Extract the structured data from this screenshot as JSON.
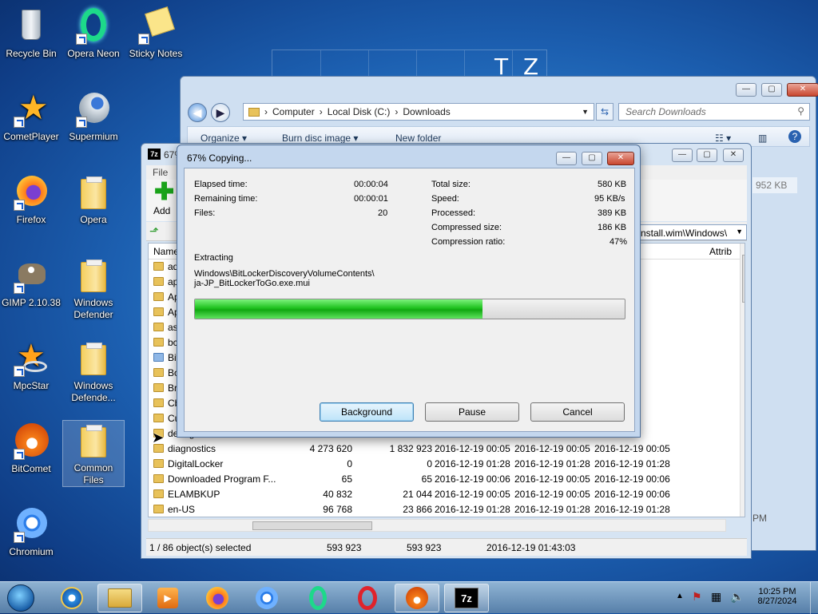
{
  "desktop": {
    "icons": [
      {
        "label": "Recycle Bin",
        "icon": "recycle-bin-icon"
      },
      {
        "label": "Opera Neon",
        "icon": "opera-neon-icon"
      },
      {
        "label": "Sticky Notes",
        "icon": "sticky-notes-icon"
      },
      {
        "label": "CometPlayer",
        "icon": "cometplayer-icon"
      },
      {
        "label": "Supermium",
        "icon": "supermium-icon"
      },
      {
        "label": "Firefox",
        "icon": "firefox-icon"
      },
      {
        "label": "Opera",
        "icon": "folder-icon"
      },
      {
        "label": "GIMP 2.10.38",
        "icon": "gimp-icon"
      },
      {
        "label": "Windows Defender",
        "icon": "folder-icon"
      },
      {
        "label": "MpcStar",
        "icon": "mpcstar-icon"
      },
      {
        "label": "Windows Defende...",
        "icon": "folder-icon"
      },
      {
        "label": "BitComet",
        "icon": "bitcomet-icon"
      },
      {
        "label": "Common Files",
        "icon": "folder-icon"
      },
      {
        "label": "Chromium",
        "icon": "chromium-icon"
      }
    ],
    "wallpaper_letters": [
      "T",
      "Z"
    ]
  },
  "explorer": {
    "breadcrumb": [
      "Computer",
      "Local Disk (C:)",
      "Downloads"
    ],
    "search_placeholder": "Search Downloads",
    "toolbar": {
      "organize": "Organize ▾",
      "burn": "Burn disc image ▾",
      "new_folder": "New folder"
    },
    "partial_size": "952 KB",
    "partial_time": "PM"
  },
  "zip": {
    "title": "67%",
    "app_icon_label": "7z",
    "menu_file": "File",
    "add_label": "Add",
    "path_text": "nstall.wim\\Windows\\",
    "col_name": "Name",
    "col_attrib": "Attrib",
    "rows": [
      {
        "name": "adc",
        "size": "",
        "packed": "",
        "modified": "",
        "created": "",
        "accessed": "9 00:05"
      },
      {
        "name": "app",
        "size": "",
        "packed": "",
        "modified": "",
        "created": "",
        "accessed": "9 00:05"
      },
      {
        "name": "Ap",
        "size": "",
        "packed": "",
        "modified": "",
        "created": "",
        "accessed": "9 01:28"
      },
      {
        "name": "Ap",
        "size": "",
        "packed": "",
        "modified": "",
        "created": "",
        "accessed": "9 00:05"
      },
      {
        "name": "ass",
        "size": "",
        "packed": "",
        "modified": "",
        "created": "",
        "accessed": "9 01:54"
      },
      {
        "name": "bca",
        "size": "",
        "packed": "",
        "modified": "",
        "created": "",
        "accessed": "9 00:05"
      },
      {
        "name": "Bit",
        "size": "",
        "packed": "",
        "modified": "",
        "created": "",
        "accessed": "9 01:43"
      },
      {
        "name": "Bo",
        "size": "",
        "packed": "",
        "modified": "",
        "created": "",
        "accessed": "9 00:05"
      },
      {
        "name": "Bra",
        "size": "",
        "packed": "",
        "modified": "",
        "created": "",
        "accessed": "9 00:05"
      },
      {
        "name": "Cb",
        "size": "",
        "packed": "",
        "modified": "",
        "created": "",
        "accessed": "9 01:44"
      },
      {
        "name": "Cu",
        "size": "",
        "packed": "",
        "modified": "",
        "created": "",
        "accessed": "9 00:05"
      },
      {
        "name": "debug",
        "size": "",
        "packed": "",
        "modified": "",
        "created": "",
        "accessed": "9 00:05"
      },
      {
        "name": "diagnostics",
        "size": "4 273 620",
        "packed": "1 832 923",
        "modified": "2016-12-19 00:05",
        "created": "2016-12-19 00:05",
        "accessed": "2016-12-19 00:05"
      },
      {
        "name": "DigitalLocker",
        "size": "0",
        "packed": "0",
        "modified": "2016-12-19 01:28",
        "created": "2016-12-19 01:28",
        "accessed": "2016-12-19 01:28"
      },
      {
        "name": "Downloaded Program F...",
        "size": "65",
        "packed": "65",
        "modified": "2016-12-19 00:06",
        "created": "2016-12-19 00:05",
        "accessed": "2016-12-19 00:06"
      },
      {
        "name": "ELAMBKUP",
        "size": "40 832",
        "packed": "21 044",
        "modified": "2016-12-19 00:05",
        "created": "2016-12-19 00:05",
        "accessed": "2016-12-19 00:06"
      },
      {
        "name": "en-US",
        "size": "96 768",
        "packed": "23 866",
        "modified": "2016-12-19 01:28",
        "created": "2016-12-19 01:28",
        "accessed": "2016-12-19 01:28"
      }
    ],
    "status": {
      "selected": "1 / 86 object(s) selected",
      "size": "593 923",
      "packed": "593 923",
      "date": "2016-12-19 01:43:03"
    }
  },
  "progress": {
    "title": "67% Copying...",
    "elapsed_label": "Elapsed time:",
    "elapsed": "00:00:04",
    "remaining_label": "Remaining time:",
    "remaining": "00:00:01",
    "files_label": "Files:",
    "files": "20",
    "total_label": "Total size:",
    "total": "580 KB",
    "speed_label": "Speed:",
    "speed": "95 KB/s",
    "processed_label": "Processed:",
    "processed": "389 KB",
    "compressed_label": "Compressed size:",
    "compressed": "186 KB",
    "ratio_label": "Compression ratio:",
    "ratio": "47%",
    "action": "Extracting",
    "file_line1": "Windows\\BitLockerDiscoveryVolumeContents\\",
    "file_line2": "ja-JP_BitLockerToGo.exe.mui",
    "percent": 67,
    "buttons": {
      "background": "Background",
      "pause": "Pause",
      "cancel": "Cancel"
    }
  },
  "taskbar": {
    "items": [
      "start-orb-icon",
      "internet-explorer-icon",
      "file-explorer-icon",
      "media-player-icon",
      "firefox-icon",
      "chromium-icon",
      "opera-neon-icon",
      "opera-icon",
      "bitcomet-icon",
      "7zip-icon"
    ],
    "time": "10:25 PM",
    "date": "8/27/2024"
  }
}
